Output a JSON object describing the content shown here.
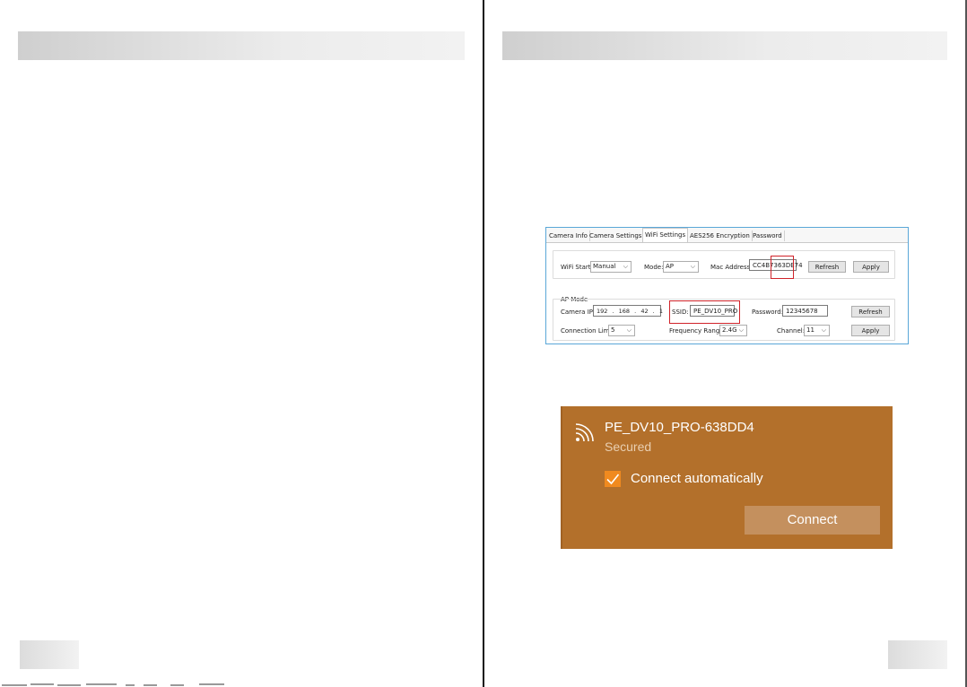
{
  "wifi_settings_window": {
    "tabs": [
      {
        "label": "Camera Info",
        "active": false
      },
      {
        "label": "Camera Settings",
        "active": false
      },
      {
        "label": "WiFi Settings",
        "active": true
      },
      {
        "label": "AES256 Encryption",
        "active": false
      },
      {
        "label": "Password",
        "active": false
      }
    ],
    "wifi_start_label": "WiFi Start:",
    "wifi_start_value": "Manual",
    "mode_label": "Mode:",
    "mode_value": "AP",
    "mac_address_label": "Mac Address:",
    "mac_address_value": "CC4B7363DE74",
    "refresh_label": "Refresh",
    "apply_label": "Apply",
    "ap_mode_title": "AP Mode",
    "camera_ip_label": "Camera IP:",
    "camera_ip_octets": [
      "192",
      "168",
      "42",
      "1"
    ],
    "ssid_label": "SSID:",
    "ssid_value": "PE_DV10_PRO",
    "password_label": "Password:",
    "password_value": "12345678",
    "connection_limit_label": "Connection Limit:",
    "connection_limit_value": "5",
    "frequency_range_label": "Frequency Range:",
    "frequency_range_value": "2.4G",
    "channel_label": "Channel:",
    "channel_value": "11"
  },
  "wifi_flyout": {
    "network_name": "PE_DV10_PRO-638DD4",
    "status": "Secured",
    "auto_connect_label": "Connect automatically",
    "auto_connect_checked": true,
    "connect_label": "Connect",
    "background_color": "#b3702b",
    "checkbox_color": "#f08a1f"
  }
}
